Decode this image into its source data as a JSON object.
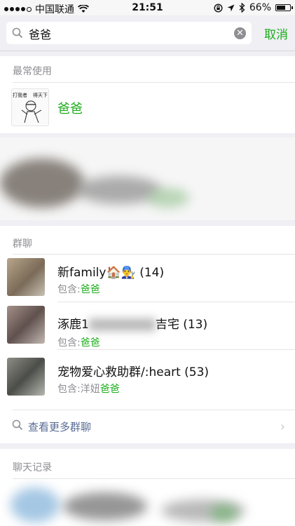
{
  "status_bar": {
    "carrier": "中国联通",
    "time": "21:51",
    "battery_percent": "66%",
    "battery_level": 0.66,
    "signal_dots_filled": 4,
    "signal_dots_total": 5
  },
  "search": {
    "query": "爸爸",
    "cancel_label": "取消"
  },
  "frequent": {
    "title": "最常使用",
    "contact": {
      "name": "爸爸",
      "avatar_text_left": "打我者",
      "avatar_text_right": "得天下"
    }
  },
  "groups": {
    "title": "群聊",
    "items": [
      {
        "name": "新family🏠👨‍🔧 (14)",
        "prefix": "包含:",
        "match": "爸爸",
        "extra": ""
      },
      {
        "name": "涿鹿1",
        "name_tail": "吉宅 (13)",
        "prefix": "包含:",
        "match": "爸爸",
        "extra": ""
      },
      {
        "name": "宠物爱心救助群/:heart (53)",
        "prefix": "包含:洋妞",
        "match": "爸爸",
        "extra": ""
      }
    ],
    "more_label": "查看更多群聊"
  },
  "chat_records": {
    "title": "聊天记录"
  },
  "colors": {
    "accent_green": "#1aad19",
    "link_blue": "#576b95",
    "gray_text": "#8e8e93"
  },
  "icons": [
    "wifi-icon",
    "lock-rotation-icon",
    "location-icon",
    "bluetooth-icon",
    "battery-icon",
    "search-icon",
    "clear-icon",
    "chevron-right-icon"
  ]
}
